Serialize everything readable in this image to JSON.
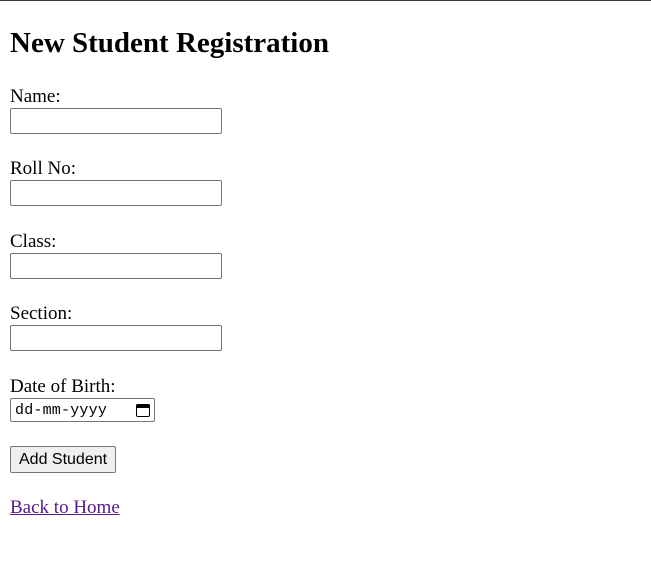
{
  "heading": "New Student Registration",
  "form": {
    "name_label": "Name:",
    "name_value": "",
    "roll_label": "Roll No:",
    "roll_value": "",
    "class_label": "Class:",
    "class_value": "",
    "section_label": "Section:",
    "section_value": "",
    "dob_label": "Date of Birth:",
    "dob_placeholder": "dd-mm-yyyy",
    "dob_icon": "calendar-icon",
    "submit_label": "Add Student"
  },
  "nav": {
    "back_link": "Back to Home"
  },
  "colors": {
    "link_visited": "#551a8b",
    "button_bg": "#efefef",
    "input_border": "#767676"
  }
}
